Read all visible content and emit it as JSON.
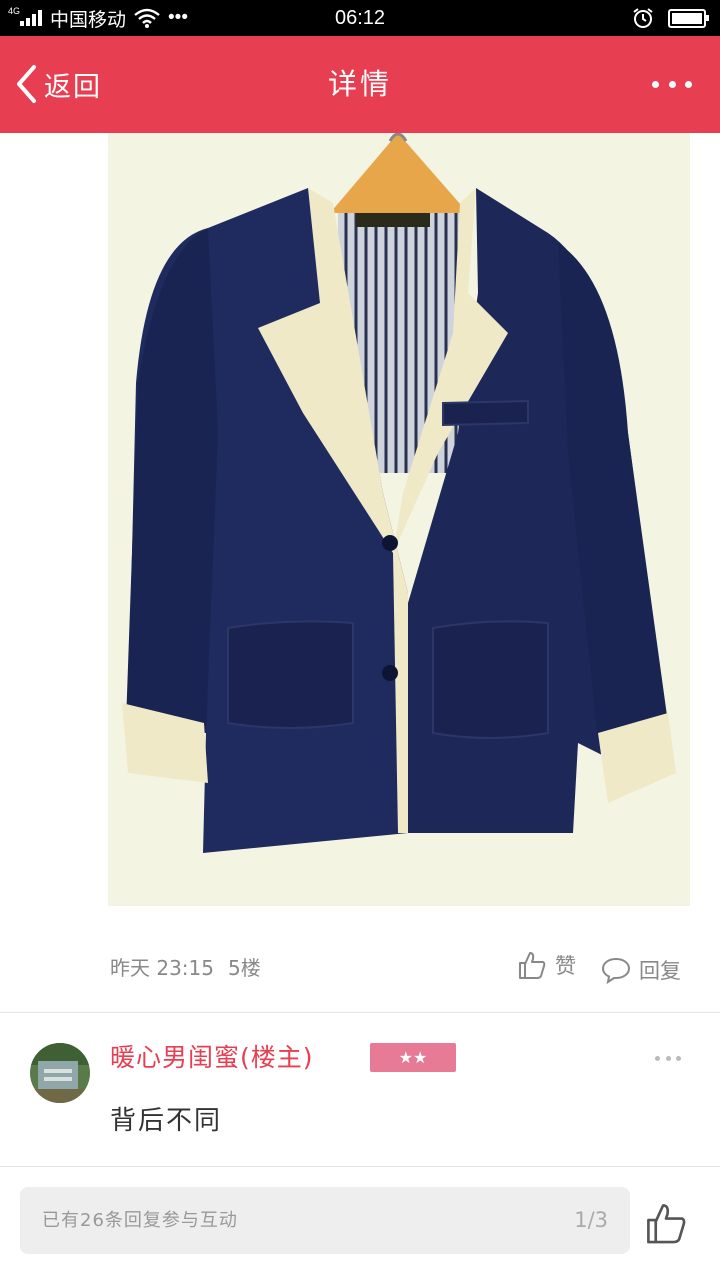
{
  "status_bar": {
    "network": "4G",
    "carrier": "中国移动",
    "extra": "•••",
    "time": "06:12"
  },
  "header": {
    "back_label": "返回",
    "title": "详情"
  },
  "post": {
    "image_icon": "jacket-photo",
    "timestamp": "昨天 23:15",
    "floor": "5楼",
    "like_label": "赞",
    "reply_label": "回复"
  },
  "reply": {
    "username": "暖心男闺蜜(楼主)",
    "badge_stars": "★★",
    "text": "背后不同"
  },
  "bottom_bar": {
    "input_placeholder": "已有26条回复参与互动",
    "page_indicator": "1/3"
  },
  "colors": {
    "accent": "#e83e51",
    "badge": "#e77b96",
    "muted_text": "#888888"
  }
}
